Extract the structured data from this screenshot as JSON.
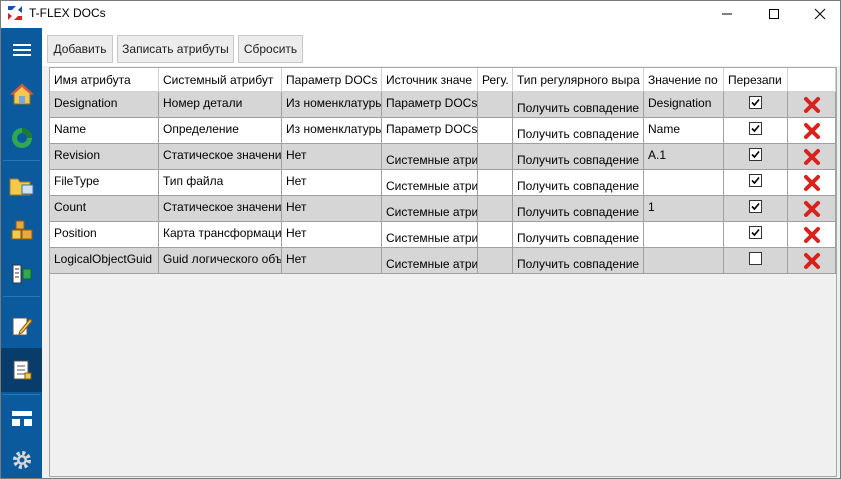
{
  "window": {
    "title": "T-FLEX DOCs",
    "colors": {
      "sidebar": "#0c5a9e",
      "sidebar_active": "#073c6b",
      "row_gray": "#d6d6d6",
      "delete_red": "#d9221c"
    }
  },
  "sidebar": {
    "items": [
      {
        "name": "menu-icon"
      },
      {
        "name": "home-icon"
      },
      {
        "name": "docs-logo-icon"
      },
      {
        "name": "folder-icon"
      },
      {
        "name": "boxes-icon"
      },
      {
        "name": "structure-icon"
      },
      {
        "name": "edit-document-icon"
      },
      {
        "name": "document-list-icon",
        "active": true
      },
      {
        "name": "hierarchy-icon"
      },
      {
        "name": "gear-icon"
      }
    ]
  },
  "toolbar": {
    "add_label": "Добавить",
    "write_label": "Записать атрибуты",
    "reset_label": "Сбросить"
  },
  "table": {
    "columns": [
      "Имя атрибута",
      "Системный атрибут",
      "Параметр DOCs",
      "Источник значе",
      "Регу.",
      "Тип регулярного выра",
      "Значение по",
      "Перезапи",
      ""
    ],
    "rows": [
      {
        "name": "Designation",
        "system": "Номер детали",
        "param": "Из номенклатуры",
        "source": "Параметр DOCs",
        "reg": "",
        "regtype": "Получить совпадение",
        "default": "Designation",
        "overwrite": true
      },
      {
        "name": "Name",
        "system": "Определение",
        "param": "Из номенклатуры",
        "source": "Параметр DOCs",
        "reg": "",
        "regtype": "Получить совпадение",
        "default": "Name",
        "overwrite": true
      },
      {
        "name": "Revision",
        "system": "Статическое значени",
        "param": "Нет",
        "source": "Системные атри",
        "reg": "",
        "regtype": "Получить совпадение",
        "default": "A.1",
        "overwrite": true
      },
      {
        "name": "FileType",
        "system": "Тип файла",
        "param": "Нет",
        "source": "Системные атри",
        "reg": "",
        "regtype": "Получить совпадение",
        "default": "",
        "overwrite": true
      },
      {
        "name": "Count",
        "system": "Статическое значени",
        "param": "Нет",
        "source": "Системные атри",
        "reg": "",
        "regtype": "Получить совпадение",
        "default": "1",
        "overwrite": true
      },
      {
        "name": "Position",
        "system": "Карта трансформаци",
        "param": "Нет",
        "source": "Системные атри",
        "reg": "",
        "regtype": "Получить совпадение",
        "default": "",
        "overwrite": true
      },
      {
        "name": "LogicalObjectGuid",
        "system": "Guid логического объ",
        "param": "Нет",
        "source": "Системные атри",
        "reg": "",
        "regtype": "Получить совпадение",
        "default": "",
        "overwrite": false
      }
    ]
  }
}
